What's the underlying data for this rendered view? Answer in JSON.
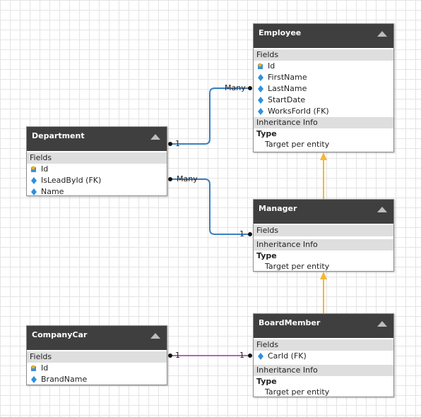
{
  "entities": {
    "employee": {
      "title": "Employee",
      "fields_header": "Fields",
      "fields": [
        "Id",
        "FirstName",
        "LastName",
        "StartDate",
        "WorksForId (FK)"
      ],
      "inheritance_header": "Inheritance Info",
      "type_label": "Type",
      "type_value": "Target per entity"
    },
    "department": {
      "title": "Department",
      "fields_header": "Fields",
      "fields": [
        "Id",
        "IsLeadById (FK)",
        "Name"
      ]
    },
    "manager": {
      "title": "Manager",
      "fields_header": "Fields",
      "inheritance_header": "Inheritance Info",
      "type_label": "Type",
      "type_value": "Target per entity"
    },
    "company_car": {
      "title": "CompanyCar",
      "fields_header": "Fields",
      "fields": [
        "Id",
        "BrandName"
      ]
    },
    "board_member": {
      "title": "BoardMember",
      "fields_header": "Fields",
      "fields": [
        "CarId (FK)"
      ],
      "inheritance_header": "Inheritance Info",
      "type_label": "Type",
      "type_value": "Target per entity"
    }
  },
  "relations": {
    "dept_employee": {
      "from_label": "1",
      "to_label": "Many"
    },
    "dept_manager": {
      "from_label": "Many",
      "to_label": "1"
    },
    "car_board": {
      "from_label": "1",
      "to_label": "1"
    }
  },
  "colors": {
    "relation_blue": "#3a7fc1",
    "relation_purple": "#b067b8",
    "inheritance": "#f5b832",
    "header_bg": "#3f3f3f",
    "section_bg": "#dedede"
  },
  "icons": {
    "primary_key": "key-icon",
    "field": "field-diamond-icon"
  }
}
